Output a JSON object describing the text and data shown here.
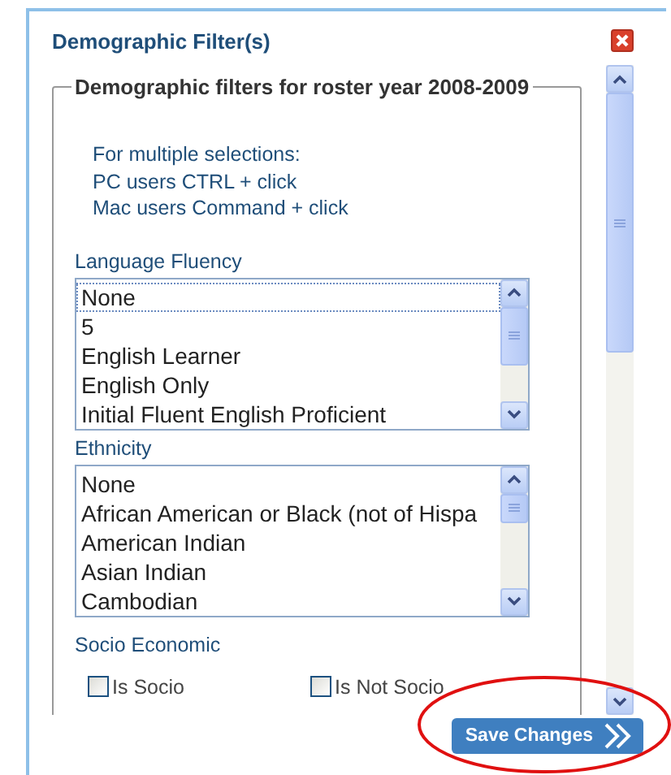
{
  "dialog": {
    "title": "Demographic Filter(s)"
  },
  "filters": {
    "legend": "Demographic filters for roster year 2008-2009",
    "instructions": [
      "For multiple selections:",
      "PC users CTRL + click",
      "Mac users Command + click"
    ],
    "lists": [
      {
        "label": "Language Fluency",
        "items": [
          {
            "text": "None",
            "selected": false,
            "focused": true
          },
          {
            "text": "5",
            "selected": false,
            "focused": false
          },
          {
            "text": "English Learner",
            "selected": false,
            "focused": false
          },
          {
            "text": "English Only",
            "selected": false,
            "focused": false
          },
          {
            "text": "Initial Fluent English Proficient",
            "selected": false,
            "focused": false
          }
        ]
      },
      {
        "label": "Ethnicity",
        "items": [
          {
            "text": "None",
            "selected": false,
            "focused": false
          },
          {
            "text": "African American or Black (not of Hispa",
            "selected": false,
            "focused": false
          },
          {
            "text": "American Indian",
            "selected": false,
            "focused": false
          },
          {
            "text": "Asian Indian",
            "selected": false,
            "focused": false
          },
          {
            "text": "Cambodian",
            "selected": false,
            "focused": false
          }
        ]
      }
    ],
    "socio": {
      "label": "Socio Economic",
      "options": [
        {
          "label": "Is Socio",
          "checked": false
        },
        {
          "label": "Is Not Socio",
          "checked": false
        }
      ]
    }
  },
  "save_button": "Save Changes"
}
